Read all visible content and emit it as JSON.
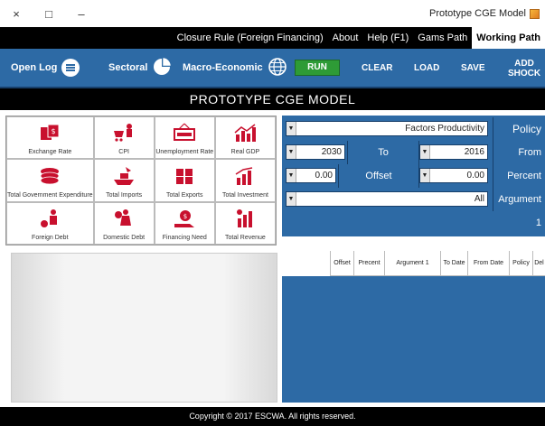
{
  "window": {
    "title": "Prototype CGE Model",
    "minimize": "–",
    "maximize": "□",
    "close": "×"
  },
  "menu": {
    "items": [
      "Closure Rule (Foreign Financing)",
      "About",
      "Help (F1)",
      "Gams Path",
      "Working Path"
    ]
  },
  "toolbar": {
    "open_log": "Open Log",
    "sectoral": "Sectoral",
    "macro": "Macro-Economic",
    "run": "RUN",
    "clear": "CLEAR",
    "load": "LOAD",
    "save": "SAVE",
    "add_shock_1": "ADD",
    "add_shock_2": "SHOCK"
  },
  "banner": "PROTOTYPE CGE MODEL",
  "tiles": [
    "Exchange Rate",
    "CPI",
    "Unemployment Rate",
    "Real GDP",
    "Total Government Expenditure",
    "Total Imports",
    "Total Exports",
    "Total Investment",
    "Foreign Debt",
    "Domestic Debt",
    "Financing Need",
    "Total Revenue"
  ],
  "form": {
    "policy_label": "Policy",
    "policy_value": "Factors Productivity",
    "from_label": "From",
    "from_value": "2016",
    "to_label": "To",
    "to_value": "2030",
    "percent_label": "Percent",
    "percent_value": "0.00",
    "offset_label": "Offset",
    "offset_value": "0.00",
    "argument_label": "Argument 1",
    "argument_value": "All"
  },
  "table": {
    "columns": [
      "Del",
      "Policy",
      "From Date",
      "To Date",
      "Argument 1",
      "Precent",
      "Offset"
    ]
  },
  "footer": "Copyright © 2017 ESCWA. All rights reserved.",
  "colors": {
    "accent": "#2d6aa5",
    "run": "#2e9b36",
    "icon": "#c8102e"
  }
}
